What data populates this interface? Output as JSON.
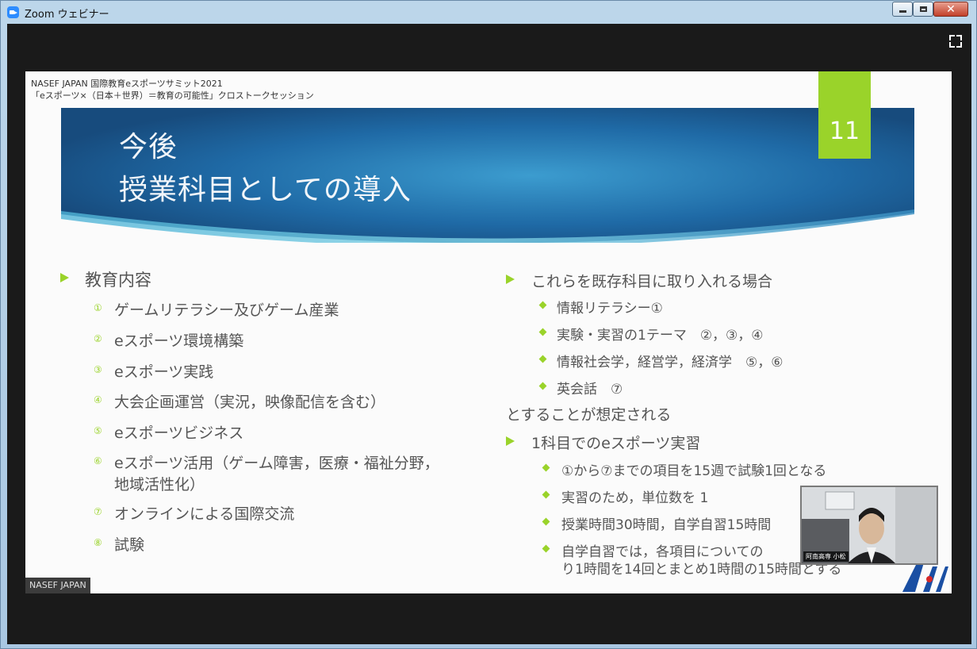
{
  "window": {
    "title": "Zoom ウェビナー",
    "controls": {
      "minimize": "",
      "maximize": "",
      "close": "✕"
    }
  },
  "slide": {
    "header_line1": "NASEF JAPAN 国際教育eスポーツサミット2021",
    "header_line2": "「eスポーツ×（日本＋世界）＝教育の可能性」クロストークセッション",
    "title_line1": "今後",
    "title_line2": "授業科目としての導入",
    "page_number": "11",
    "left_heading": "教育内容",
    "left_items": [
      {
        "num": "①",
        "text": "ゲームリテラシー及びゲーム産業"
      },
      {
        "num": "②",
        "text": "eスポーツ環境構築"
      },
      {
        "num": "③",
        "text": "eスポーツ実践"
      },
      {
        "num": "④",
        "text": "大会企画運営（実況，映像配信を含む）"
      },
      {
        "num": "⑤",
        "text": "eスポーツビジネス"
      },
      {
        "num": "⑥",
        "text": "eスポーツ活用（ゲーム障害，医療・福祉分野，",
        "text2": "地域活性化）"
      },
      {
        "num": "⑦",
        "text": "オンラインによる国際交流"
      },
      {
        "num": "⑧",
        "text": "試験"
      }
    ],
    "right_heading1": "これらを既存科目に取り入れる場合",
    "right_sub1": [
      "情報リテラシー①",
      "実験・実習の1テーマ　②，③，④",
      "情報社会学，経営学，経済学　⑤，⑥",
      "英会話　⑦"
    ],
    "right_note": "とすることが想定される",
    "right_heading2": "1科目でのeスポーツ実習",
    "right_sub2": [
      "①から⑦までの項目を15週で試験1回となる",
      "実習のため，単位数を 1",
      "授業時間30時間，自学自習15時間"
    ],
    "right_sub2_last_line1": "自学自習では，各項目についての",
    "right_sub2_last_line2": "り1時間を14回とまとめ1時間の15時間とする"
  },
  "watermark": "NASEF JAPAN",
  "self_video": {
    "name_label": "阿南高専 小松"
  },
  "icons": {
    "app": "zoom-app-icon",
    "fullscreen": "fullscreen-icon",
    "logo": "school-logo"
  },
  "colors": {
    "accent_green": "#9ad32a",
    "banner_blue": "#1b5a8f",
    "text_gray": "#555555"
  }
}
